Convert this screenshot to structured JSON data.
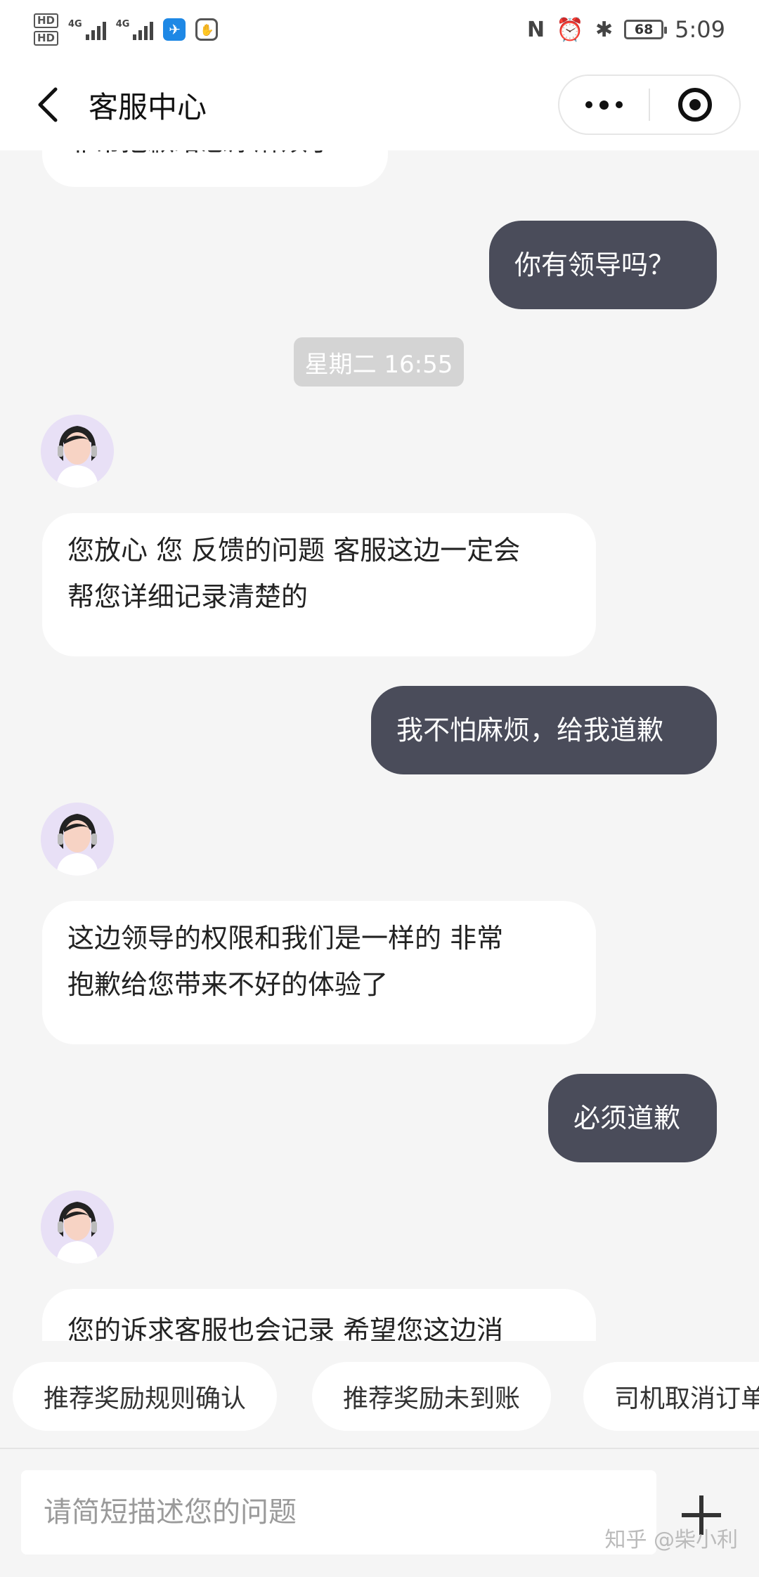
{
  "status_bar": {
    "hd1": "HD",
    "hd2": "HD",
    "net1": "4G",
    "net2": "4G",
    "battery": "68",
    "time": "5:09"
  },
  "nav": {
    "title": "客服中心"
  },
  "chat": {
    "messages": [
      {
        "role": "agent",
        "text": "非常抱歉给您添麻烦了"
      },
      {
        "role": "user",
        "text": "你有领导吗？"
      },
      {
        "role": "timestamp",
        "text": "星期二 16:55"
      },
      {
        "role": "agent",
        "line1": "您放心 您 反馈的问题 客服这边一定会",
        "line2": "帮您详细记录清楚的"
      },
      {
        "role": "user",
        "text": "我不怕麻烦，给我道歉"
      },
      {
        "role": "agent",
        "line1": "这边领导的权限和我们是一样的 非常",
        "line2": "抱歉给您带来不好的体验了"
      },
      {
        "role": "user",
        "text": "必须道歉"
      },
      {
        "role": "agent",
        "text": "您的诉求客服也会记录 希望您这边消"
      }
    ]
  },
  "quick_replies": [
    "推荐奖励规则确认",
    "推荐奖励未到账",
    "司机取消订单"
  ],
  "input": {
    "placeholder": "请简短描述您的问题",
    "value": ""
  },
  "watermark": "知乎 @柴小利",
  "colors": {
    "user_bubble": "#4a4c5a",
    "agent_bubble": "#ffffff",
    "background": "#f5f5f5"
  }
}
